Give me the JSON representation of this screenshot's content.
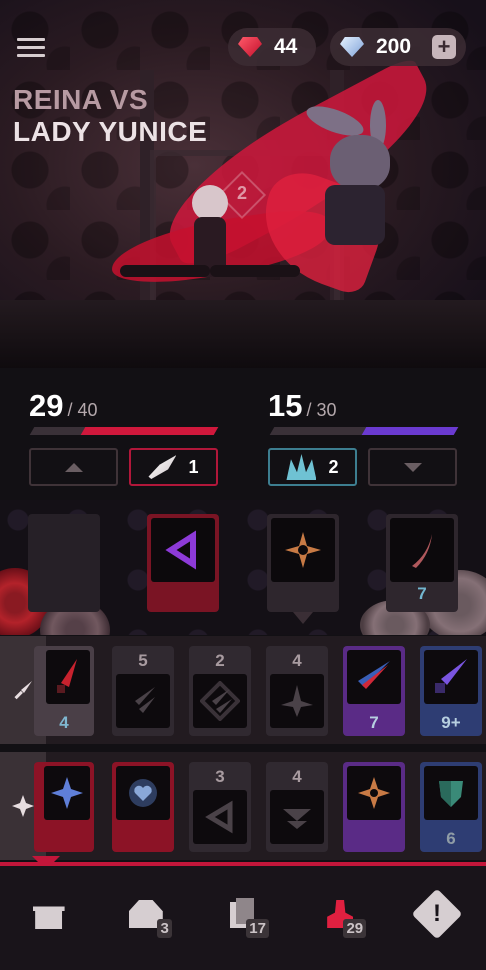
{
  "header": {
    "title_line1": "REINA VS",
    "title_line2": "LADY YUNICE",
    "rubies": "44",
    "diamonds": "200",
    "plus": "+",
    "stage_number": "2"
  },
  "player": {
    "hp_current": "29",
    "hp_max": "/ 40",
    "hp_fraction": 0.725,
    "intent_value": "1",
    "color": "#d0183c"
  },
  "enemy": {
    "hp_current": "15",
    "hp_max": "/ 30",
    "hp_fraction": 0.5,
    "intent_value": "2",
    "color": "#6a3ad0"
  },
  "board": {
    "slot4_count": "7"
  },
  "inventory": {
    "row1": {
      "tab_icon": "dagger-icon",
      "cards": [
        {
          "bottom": "4"
        },
        {
          "top": "5"
        },
        {
          "top": "2"
        },
        {
          "top": "4"
        },
        {
          "bottom": "7"
        },
        {
          "bottom": "9+"
        }
      ]
    },
    "row2": {
      "tab_icon": "sparkle-icon",
      "cards": [
        {},
        {},
        {
          "top": "3"
        },
        {
          "top": "4"
        },
        {},
        {
          "bottom": "6"
        }
      ]
    }
  },
  "nav": {
    "items": [
      {
        "icon": "gift-icon"
      },
      {
        "icon": "chest-icon",
        "badge": "3"
      },
      {
        "icon": "deck-icon",
        "badge": "17"
      },
      {
        "icon": "player-icon",
        "badge": "29"
      },
      {
        "icon": "alert-icon",
        "label": "!"
      }
    ]
  },
  "colors": {
    "accent": "#c2163a",
    "purple": "#5a2b86",
    "blue": "#2e3d73",
    "red_card": "#8c1326"
  }
}
